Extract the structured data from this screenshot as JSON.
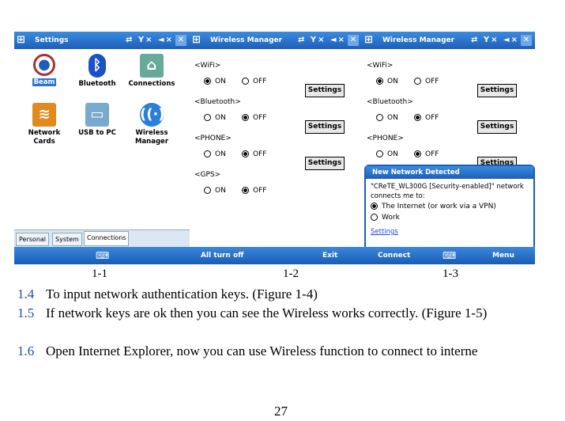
{
  "screen1": {
    "title": "Settings",
    "icons": [
      {
        "label": "Beam",
        "icon": "beam-icon"
      },
      {
        "label": "Bluetooth",
        "icon": "bluetooth-icon"
      },
      {
        "label": "Connections",
        "icon": "connections-icon"
      },
      {
        "label": "Network Cards",
        "icon": "network-cards-icon"
      },
      {
        "label": "USB to PC",
        "icon": "usb-icon"
      },
      {
        "label": "Wireless Manager",
        "icon": "wireless-manager-icon"
      }
    ],
    "tabs": [
      "Personal",
      "System",
      "Connections"
    ],
    "status": "⇄ Y× ◄×",
    "close": "✕",
    "keyboard": "⌨"
  },
  "screen2": {
    "title": "Wireless Manager",
    "status": "⇄ Y× ◄×",
    "close": "✕",
    "sections": [
      {
        "label": "<WiFi>",
        "on": "ON",
        "off": "OFF",
        "selected": "on",
        "button": "Settings"
      },
      {
        "label": "<Bluetooth>",
        "on": "ON",
        "off": "OFF",
        "selected": "off",
        "button": "Settings"
      },
      {
        "label": "<PHONE>",
        "on": "ON",
        "off": "OFF",
        "selected": "off",
        "button": "Settings"
      },
      {
        "label": "<GPS>",
        "on": "ON",
        "off": "OFF",
        "selected": "off"
      }
    ],
    "left_soft": "All turn off",
    "right_soft": "Exit"
  },
  "screen3": {
    "title": "Wireless Manager",
    "status": "⇄ Y× ◄×",
    "close": "✕",
    "sections": [
      {
        "label": "<WiFi>",
        "on": "ON",
        "off": "OFF",
        "selected": "on",
        "button": "Settings"
      },
      {
        "label": "<Bluetooth>",
        "on": "ON",
        "off": "OFF",
        "selected": "off",
        "button": "Settings"
      },
      {
        "label": "<PHONE>",
        "on": "ON",
        "off": "OFF",
        "selected": "off",
        "button": "Settings"
      }
    ],
    "dialog": {
      "title": "New Network Detected",
      "message": "\"CReTE_WL300G [Security-enabled]\" network connects me to:",
      "options": [
        "The Internet (or work via a VPN)",
        "Work"
      ],
      "selected": 0,
      "link": "Settings"
    },
    "left_soft": "Connect",
    "keyboard": "⌨",
    "right_soft": "Menu"
  },
  "captions": [
    "1-1",
    "1-2",
    "1-3"
  ],
  "steps": [
    {
      "num": "1.4",
      "text": "To input network authentication keys. (Figure 1-4)"
    },
    {
      "num": "1.5",
      "text": "If network keys are ok then you can see the Wireless works correctly. (Figure 1-5)"
    },
    {
      "num": "1.6",
      "text": "Open Internet Explorer, now you can use Wireless function to connect to interne"
    }
  ],
  "page_number": "27"
}
